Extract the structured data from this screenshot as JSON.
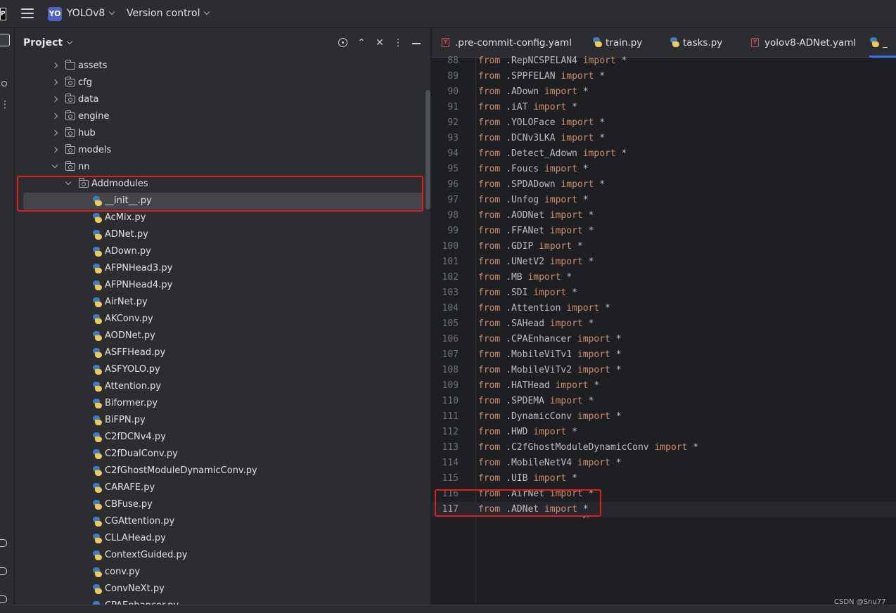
{
  "app": {
    "logo_text": "PC"
  },
  "titlebar": {
    "project_badge": "YO",
    "project_name": "YOLOv8",
    "version_control": "Version control"
  },
  "project_panel": {
    "title": "Project",
    "tree": [
      {
        "label": "assets",
        "type": "folder",
        "expanded": false,
        "depth": 0
      },
      {
        "label": "cfg",
        "type": "package",
        "expanded": false,
        "depth": 0
      },
      {
        "label": "data",
        "type": "package",
        "expanded": false,
        "depth": 0
      },
      {
        "label": "engine",
        "type": "package",
        "expanded": false,
        "depth": 0
      },
      {
        "label": "hub",
        "type": "package",
        "expanded": false,
        "depth": 0
      },
      {
        "label": "models",
        "type": "package",
        "expanded": false,
        "depth": 0
      },
      {
        "label": "nn",
        "type": "package",
        "expanded": true,
        "depth": 0
      },
      {
        "label": "Addmodules",
        "type": "package",
        "expanded": true,
        "depth": 1
      },
      {
        "label": "__init__.py",
        "type": "py",
        "depth": 2,
        "selected": true
      },
      {
        "label": "AcMix.py",
        "type": "py",
        "depth": 2
      },
      {
        "label": "ADNet.py",
        "type": "py",
        "depth": 2
      },
      {
        "label": "ADown.py",
        "type": "py",
        "depth": 2
      },
      {
        "label": "AFPNHead3.py",
        "type": "py",
        "depth": 2
      },
      {
        "label": "AFPNHead4.py",
        "type": "py",
        "depth": 2
      },
      {
        "label": "AirNet.py",
        "type": "py",
        "depth": 2
      },
      {
        "label": "AKConv.py",
        "type": "py",
        "depth": 2
      },
      {
        "label": "AODNet.py",
        "type": "py",
        "depth": 2
      },
      {
        "label": "ASFFHead.py",
        "type": "py",
        "depth": 2
      },
      {
        "label": "ASFYOLO.py",
        "type": "py",
        "depth": 2
      },
      {
        "label": "Attention.py",
        "type": "py",
        "depth": 2
      },
      {
        "label": "Biformer.py",
        "type": "py",
        "depth": 2
      },
      {
        "label": "BiFPN.py",
        "type": "py",
        "depth": 2
      },
      {
        "label": "C2fDCNv4.py",
        "type": "py",
        "depth": 2
      },
      {
        "label": "C2fDualConv.py",
        "type": "py",
        "depth": 2
      },
      {
        "label": "C2fGhostModuleDynamicConv.py",
        "type": "py",
        "depth": 2
      },
      {
        "label": "CARAFE.py",
        "type": "py",
        "depth": 2
      },
      {
        "label": "CBFuse.py",
        "type": "py",
        "depth": 2
      },
      {
        "label": "CGAttention.py",
        "type": "py",
        "depth": 2
      },
      {
        "label": "CLLAHead.py",
        "type": "py",
        "depth": 2
      },
      {
        "label": "ContextGuided.py",
        "type": "py",
        "depth": 2
      },
      {
        "label": "conv.py",
        "type": "py",
        "depth": 2
      },
      {
        "label": "ConvNeXt.py",
        "type": "py",
        "depth": 2
      },
      {
        "label": "CPAEnhancer.py",
        "type": "py",
        "depth": 2
      }
    ]
  },
  "editor": {
    "tabs": [
      {
        "label": ".pre-commit-config.yaml",
        "type": "yaml",
        "active": false
      },
      {
        "label": "train.py",
        "type": "py",
        "active": false
      },
      {
        "label": "tasks.py",
        "type": "py",
        "active": false
      },
      {
        "label": "yolov8-ADNet.yaml",
        "type": "yaml",
        "active": false
      },
      {
        "label": "_",
        "type": "py",
        "active": true
      }
    ],
    "keyword_from": "from",
    "keyword_import": "import",
    "star": "*",
    "lines": [
      {
        "num": "88",
        "module": ".RepNCSPELAN4"
      },
      {
        "num": "89",
        "module": ".SPPFELAN"
      },
      {
        "num": "90",
        "module": ".ADown"
      },
      {
        "num": "91",
        "module": ".iAT"
      },
      {
        "num": "92",
        "module": ".YOLOFace"
      },
      {
        "num": "93",
        "module": ".DCNv3LKA"
      },
      {
        "num": "94",
        "module": ".Detect_Adown"
      },
      {
        "num": "95",
        "module": ".Foucs"
      },
      {
        "num": "96",
        "module": ".SPDADown"
      },
      {
        "num": "97",
        "module": ".Unfog"
      },
      {
        "num": "98",
        "module": ".AODNet"
      },
      {
        "num": "99",
        "module": ".FFANet"
      },
      {
        "num": "100",
        "module": ".GDIP"
      },
      {
        "num": "101",
        "module": ".UNetV2"
      },
      {
        "num": "102",
        "module": ".MB"
      },
      {
        "num": "103",
        "module": ".SDI"
      },
      {
        "num": "104",
        "module": ".Attention"
      },
      {
        "num": "105",
        "module": ".SAHead"
      },
      {
        "num": "106",
        "module": ".CPAEnhancer"
      },
      {
        "num": "107",
        "module": ".MobileViTv1"
      },
      {
        "num": "108",
        "module": ".MobileViTv2"
      },
      {
        "num": "109",
        "module": ".HATHead"
      },
      {
        "num": "110",
        "module": ".SPDEMA"
      },
      {
        "num": "111",
        "module": ".DynamicConv"
      },
      {
        "num": "112",
        "module": ".HWD"
      },
      {
        "num": "113",
        "module": ".C2fGhostModuleDynamicConv"
      },
      {
        "num": "114",
        "module": ".MobileNetV4"
      },
      {
        "num": "115",
        "module": ".UIB"
      },
      {
        "num": "116",
        "module": ".AirNet"
      },
      {
        "num": "117",
        "module": ".ADNet",
        "current": true
      }
    ]
  },
  "watermark": "CSDN @Snu77",
  "colors": {
    "highlight_box": "#e0201b",
    "keyword": "#cf8e6d",
    "accent": "#3574f0"
  }
}
